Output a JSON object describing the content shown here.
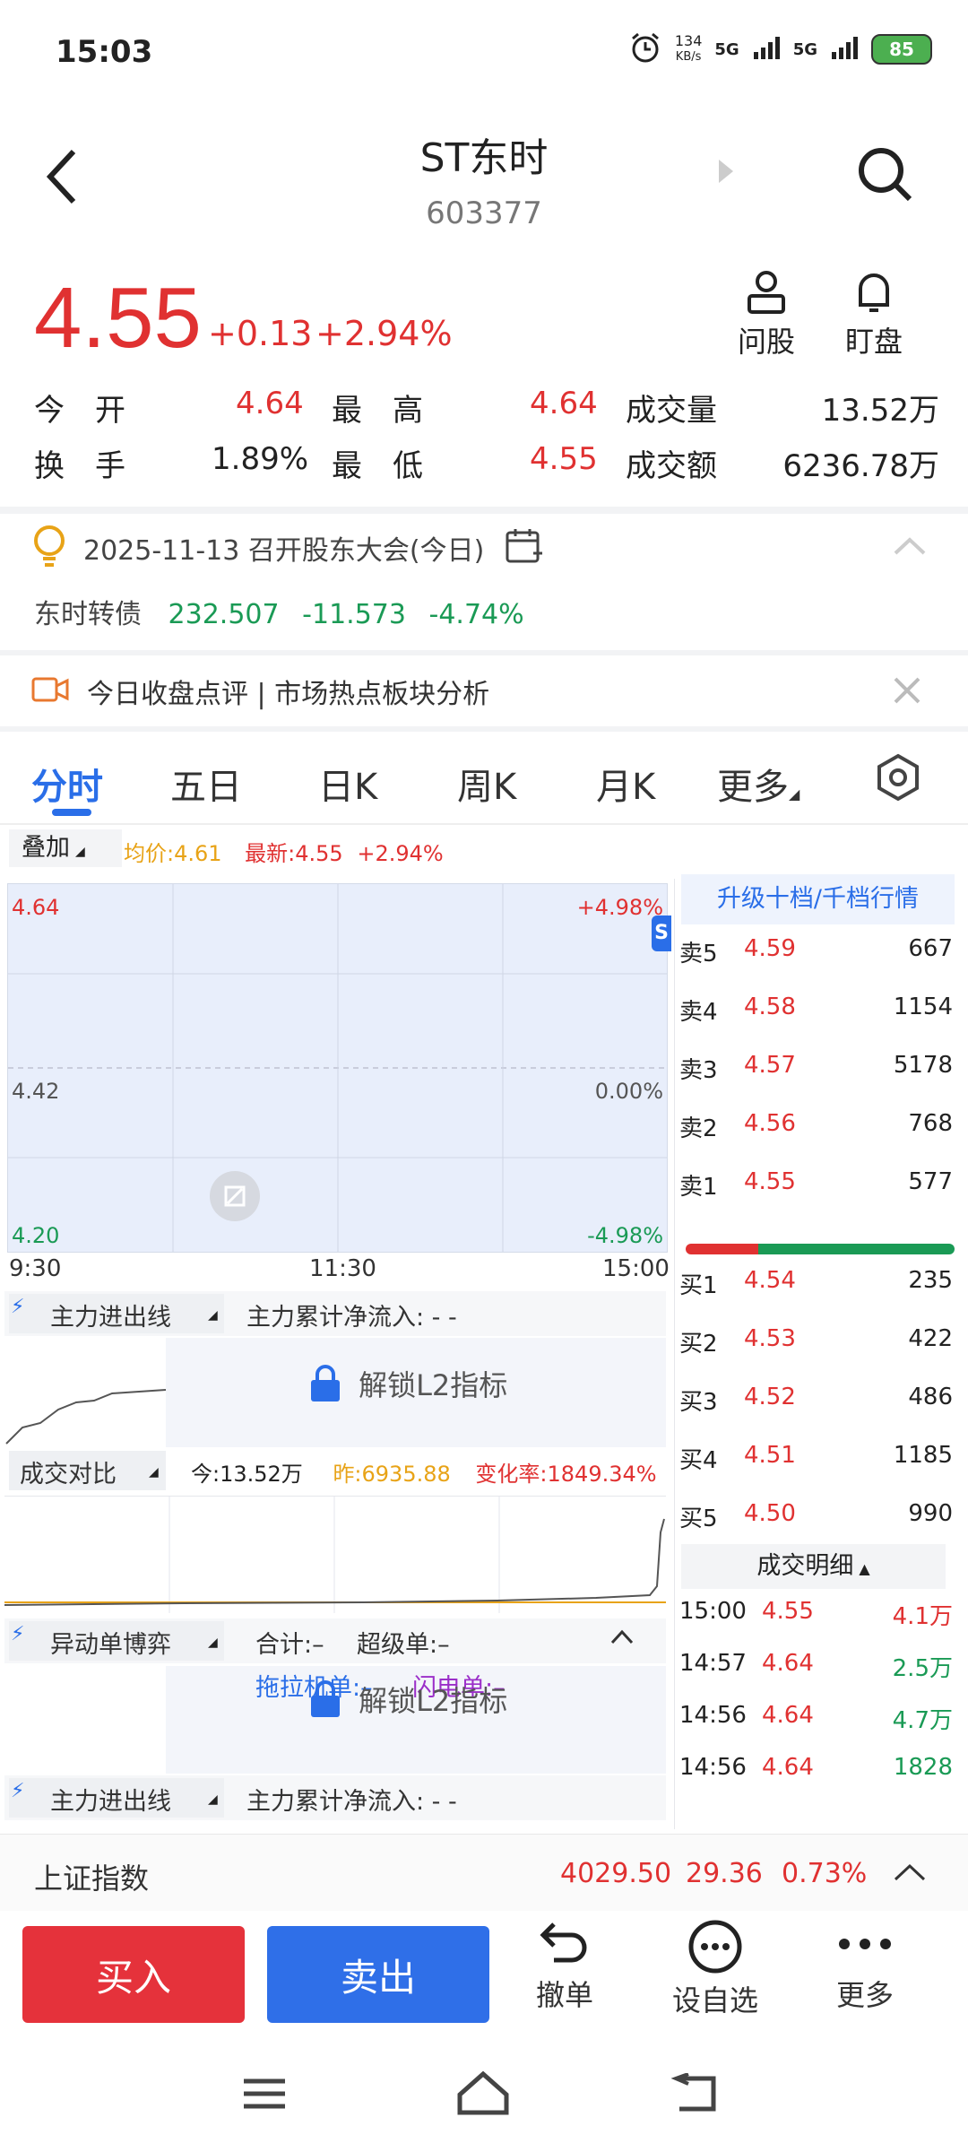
{
  "status": {
    "time": "15:03",
    "speed": "134",
    "speed_unit": "KB/s",
    "net1": "5G",
    "net2": "5G",
    "battery": "85"
  },
  "header": {
    "name": "ST东时",
    "code": "603377",
    "ask_label": "问股",
    "watch_label": "盯盘"
  },
  "price": {
    "last": "4.55",
    "change": "+0.13",
    "change_pct": "+2.94%"
  },
  "quote": {
    "open_label": "今　开",
    "open": "4.64",
    "high_label": "最　高",
    "high": "4.64",
    "volume_label": "成交量",
    "volume": "13.52万",
    "turnover_label": "换　手",
    "turnover": "1.89%",
    "low_label": "最　低",
    "low": "4.55",
    "amount_label": "成交额",
    "amount": "6236.78万"
  },
  "notice": {
    "event": "2025-11-13 召开股东大会(今日)",
    "bond_name": "东时转债",
    "bond_price": "232.507",
    "bond_change": "-11.573",
    "bond_pct": "-4.74%",
    "review": "今日收盘点评 | 市场热点板块分析"
  },
  "tabs": [
    "分时",
    "五日",
    "日K",
    "周K",
    "月K",
    "更多"
  ],
  "chart": {
    "overlay_label": "叠加",
    "avg_label": "均价:4.61",
    "latest_label": "最新:4.55",
    "latest_pct": "+2.94%",
    "y_top": "4.64",
    "y_mid": "4.42",
    "y_bot": "4.20",
    "pct_top": "+4.98%",
    "pct_mid": "0.00%",
    "pct_bot": "-4.98%",
    "x_start": "9:30",
    "x_mid": "11:30",
    "x_end": "15:00",
    "s_badge": "S"
  },
  "indicators": {
    "main_flow": "主力进出线",
    "main_net": "主力累计净流入: - -",
    "unlock": "解锁L2指标",
    "volume_cmp": "成交对比",
    "today": "今:13.52万",
    "yesterday": "昨:6935.88",
    "change_rate": "变化率:1849.34%",
    "game": "异动单博弈",
    "total": "合计:–",
    "super": "超级单:–",
    "tractor": "拖拉机单:–",
    "flash": "闪电单:–"
  },
  "orderbook": {
    "upgrade": "升级十档/千档行情",
    "asks": [
      {
        "label": "卖5",
        "price": "4.59",
        "vol": "667"
      },
      {
        "label": "卖4",
        "price": "4.58",
        "vol": "1154"
      },
      {
        "label": "卖3",
        "price": "4.57",
        "vol": "5178"
      },
      {
        "label": "卖2",
        "price": "4.56",
        "vol": "768"
      },
      {
        "label": "卖1",
        "price": "4.55",
        "vol": "577"
      }
    ],
    "bids": [
      {
        "label": "买1",
        "price": "4.54",
        "vol": "235"
      },
      {
        "label": "买2",
        "price": "4.53",
        "vol": "422"
      },
      {
        "label": "买3",
        "price": "4.52",
        "vol": "486"
      },
      {
        "label": "买4",
        "price": "4.51",
        "vol": "1185"
      },
      {
        "label": "买5",
        "price": "4.50",
        "vol": "990"
      }
    ],
    "detail_label": "成交明细",
    "trades": [
      {
        "time": "15:00",
        "price": "4.55",
        "vol": "4.1万"
      },
      {
        "time": "14:57",
        "price": "4.64",
        "vol": "2.5万"
      },
      {
        "time": "14:56",
        "price": "4.64",
        "vol": "4.7万"
      },
      {
        "time": "14:56",
        "price": "4.64",
        "vol": "1828"
      }
    ]
  },
  "index": {
    "name": "上证指数",
    "value": "4029.50",
    "change": "29.36",
    "pct": "0.73%"
  },
  "actions": {
    "buy": "买入",
    "sell": "卖出",
    "cancel": "撤单",
    "watchlist": "设自选",
    "more": "更多"
  },
  "colors": {
    "up": "#e03131",
    "down": "#1a9a55",
    "accent": "#2a6ee8",
    "buy_bg": "#e5323b",
    "sell_bg": "#2f6fe8"
  }
}
